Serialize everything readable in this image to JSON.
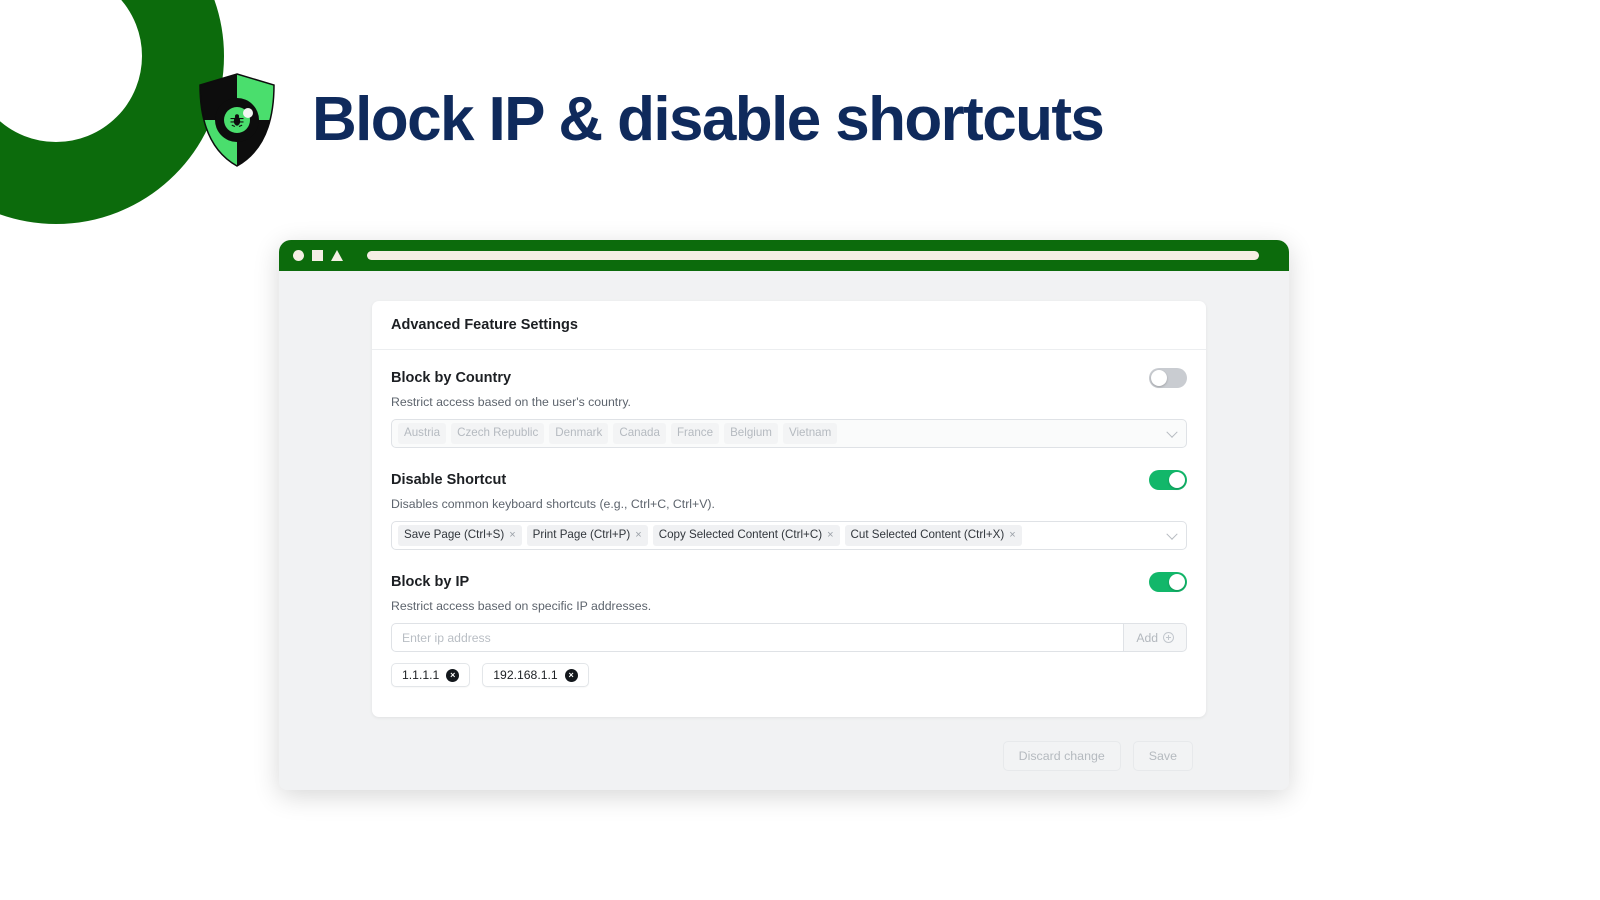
{
  "hero": {
    "title": "Block IP & disable shortcuts",
    "logo_icon": "shield-bug-icon",
    "brand_green": "#0c6b0c",
    "brand_light_green": "#4ade6d",
    "title_color": "#0f2a5c"
  },
  "browser": {
    "controls": [
      "circle-icon",
      "square-icon",
      "triangle-icon"
    ],
    "url_value": ""
  },
  "card": {
    "title": "Advanced Feature Settings"
  },
  "sections": [
    {
      "title": "Block by Country",
      "description": "Restrict access based on the user's country.",
      "toggle_on": false,
      "field_type": "multiselect",
      "disabled": true,
      "tags": [
        {
          "label": "Austria"
        },
        {
          "label": "Czech Republic"
        },
        {
          "label": "Denmark"
        },
        {
          "label": "Canada"
        },
        {
          "label": "France"
        },
        {
          "label": "Belgium"
        },
        {
          "label": "Vietnam"
        }
      ]
    },
    {
      "title": "Disable Shortcut",
      "description": "Disables common keyboard shortcuts (e.g., Ctrl+C, Ctrl+V).",
      "toggle_on": true,
      "field_type": "multiselect",
      "disabled": false,
      "tags": [
        {
          "label": "Save Page (Ctrl+S)",
          "remove": "×"
        },
        {
          "label": "Print Page (Ctrl+P)",
          "remove": "×"
        },
        {
          "label": "Copy Selected Content (Ctrl+C)",
          "remove": "×"
        },
        {
          "label": "Cut Selected Content (Ctrl+X)",
          "remove": "×"
        }
      ]
    },
    {
      "title": "Block by IP",
      "description": "Restrict access based on specific IP addresses.",
      "toggle_on": true,
      "field_type": "ip-input",
      "input_value": "",
      "input_placeholder": "Enter ip address",
      "add_label": "Add",
      "add_icon": "plus-circle-icon",
      "chips": [
        {
          "label": "1.1.1.1",
          "remove": "×"
        },
        {
          "label": "192.168.1.1",
          "remove": "×"
        }
      ]
    }
  ],
  "footer": {
    "discard_label": "Discard change",
    "save_label": "Save"
  },
  "colors": {
    "toggle_on": "#12b76a",
    "toggle_off": "#c9ccd1"
  }
}
